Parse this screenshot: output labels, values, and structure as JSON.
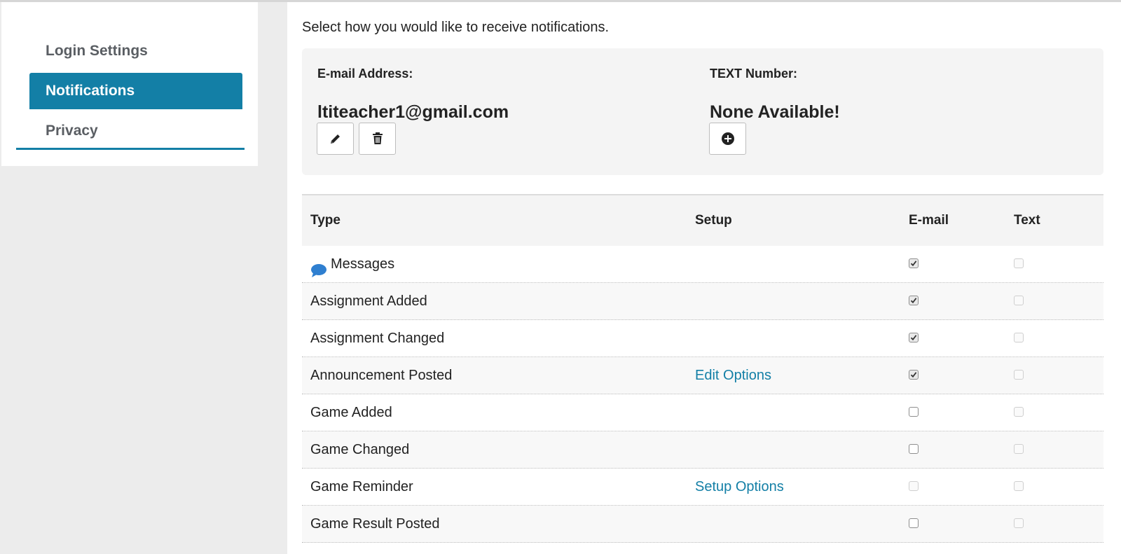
{
  "sidebar": {
    "items": [
      {
        "label": "Login Settings",
        "active": false
      },
      {
        "label": "Notifications",
        "active": true
      },
      {
        "label": "Privacy",
        "active": false
      }
    ]
  },
  "main": {
    "intro": "Select how you would like to receive notifications.",
    "email": {
      "label": "E-mail Address:",
      "value": "ltiteacher1@gmail.com",
      "edit_icon": "pencil-icon",
      "delete_icon": "trash-icon"
    },
    "text": {
      "label": "TEXT Number:",
      "value": "None Available!",
      "add_icon": "plus-circle-icon"
    }
  },
  "table": {
    "headers": {
      "type": "Type",
      "setup": "Setup",
      "email": "E-mail",
      "text": "Text"
    },
    "rows": [
      {
        "type": "Messages",
        "icon": "chat-bubble-icon",
        "setup": "",
        "email_checked": true,
        "email_enabled": true,
        "text_checked": false,
        "text_enabled": false
      },
      {
        "type": "Assignment Added",
        "setup": "",
        "email_checked": true,
        "email_enabled": true,
        "text_checked": false,
        "text_enabled": false
      },
      {
        "type": "Assignment Changed",
        "setup": "",
        "email_checked": true,
        "email_enabled": true,
        "text_checked": false,
        "text_enabled": false
      },
      {
        "type": "Announcement Posted",
        "setup": "Edit Options",
        "email_checked": true,
        "email_enabled": true,
        "text_checked": false,
        "text_enabled": false
      },
      {
        "type": "Game Added",
        "setup": "",
        "email_checked": false,
        "email_enabled": true,
        "text_checked": false,
        "text_enabled": false
      },
      {
        "type": "Game Changed",
        "setup": "",
        "email_checked": false,
        "email_enabled": true,
        "text_checked": false,
        "text_enabled": false
      },
      {
        "type": "Game Reminder",
        "setup": "Setup Options",
        "email_checked": false,
        "email_enabled": false,
        "text_checked": false,
        "text_enabled": false
      },
      {
        "type": "Game Result Posted",
        "setup": "",
        "email_checked": false,
        "email_enabled": true,
        "text_checked": false,
        "text_enabled": false
      }
    ]
  },
  "colors": {
    "accent": "#137fa6",
    "chat_icon": "#2f7fd0"
  }
}
